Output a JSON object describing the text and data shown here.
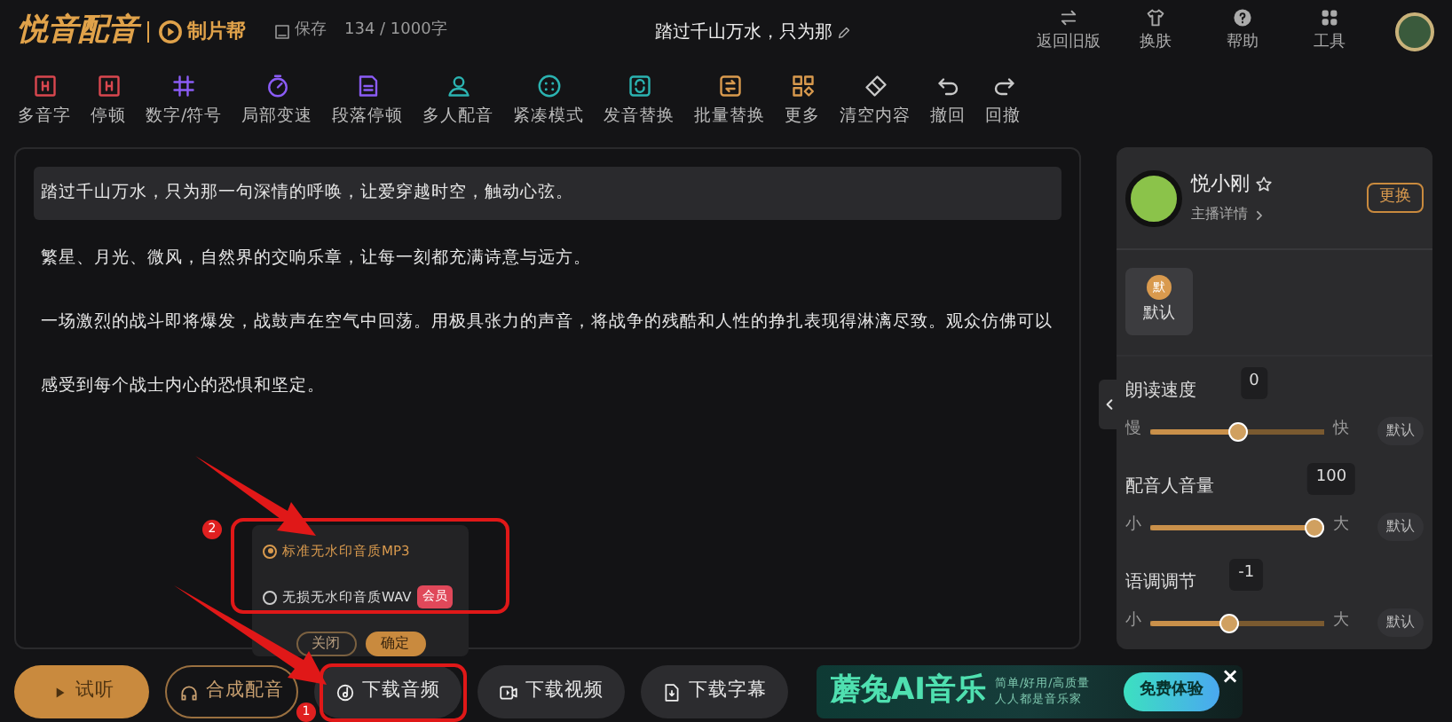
{
  "header": {
    "logo": "悦音配音",
    "brand": "制片帮",
    "save": "保存",
    "count": "134 / 1000字",
    "title": "踏过千山万水，只为那",
    "actions": [
      {
        "label": "返回旧版",
        "kind": "swap"
      },
      {
        "label": "换肤",
        "kind": "shirt"
      },
      {
        "label": "帮助",
        "kind": "help"
      },
      {
        "label": "工具",
        "kind": "grid"
      }
    ]
  },
  "toolbar": [
    {
      "label": "多音字",
      "kind": "framed",
      "color": "#d9474f"
    },
    {
      "label": "停顿",
      "kind": "framed",
      "color": "#d9474f"
    },
    {
      "label": "数字/符号",
      "kind": "hash",
      "color": "#8b5cf6"
    },
    {
      "label": "局部变速",
      "kind": "timer",
      "color": "#8b5cf6"
    },
    {
      "label": "段落停顿",
      "kind": "doc",
      "color": "#8b5cf6"
    },
    {
      "label": "多人配音",
      "kind": "people",
      "color": "#2bb3b1"
    },
    {
      "label": "紧凑模式",
      "kind": "dots",
      "color": "#2bb3b1"
    },
    {
      "label": "发音替换",
      "kind": "cycle",
      "color": "#2bb3b1"
    },
    {
      "label": "批量替换",
      "kind": "swapbox",
      "color": "#d99a4e"
    },
    {
      "label": "更多",
      "kind": "more",
      "color": "#d99a4e"
    },
    {
      "label": "清空内容",
      "kind": "brush",
      "color": "#c9c9c9"
    },
    {
      "label": "撤回",
      "kind": "undo",
      "color": "#c9c9c9"
    },
    {
      "label": "回撤",
      "kind": "redo",
      "color": "#c9c9c9"
    }
  ],
  "editor": {
    "paragraphs": [
      {
        "text": "踏过千山万水，只为那一句深情的呼唤，让爱穿越时空，触动心弦。",
        "selected": true
      },
      {
        "text": "繁星、月光、微风，自然界的交响乐章，让每一刻都充满诗意与远方。",
        "selected": false
      },
      {
        "text": "一场激烈的战斗即将爆发，战鼓声在空气中回荡。用极具张力的声音，将战争的残酷和人性的挣扎表现得淋漓尽致。观众仿佛可以感受到每个战士内心的恐惧和坚定。",
        "selected": false
      }
    ]
  },
  "download_popup": {
    "options": [
      {
        "label": "标准无水印音质MP3",
        "selected": true
      },
      {
        "label": "无损无水印音质WAV",
        "selected": false,
        "badge": "会员"
      }
    ],
    "buttons": [
      {
        "label": "关闭",
        "kind": "outline"
      },
      {
        "label": "确定",
        "kind": "primary"
      }
    ]
  },
  "voice_panel": {
    "name": "悦小刚",
    "detail": "主播详情",
    "change": "更换",
    "emotions": [
      {
        "label": "默认",
        "icon_text": "默",
        "selected": true
      }
    ],
    "sliders": [
      {
        "label": "朗读速度",
        "reading": "0",
        "min_label": "慢",
        "max_label": "快",
        "level": 0.5,
        "reset": "默认"
      },
      {
        "label": "配音人音量",
        "reading": "100",
        "min_label": "小",
        "max_label": "大",
        "level": 1.0,
        "reset": "默认"
      },
      {
        "label": "语调调节",
        "reading": "-1",
        "min_label": "小",
        "max_label": "大",
        "level": 0.45,
        "reset": "默认"
      }
    ]
  },
  "bottom_bar": {
    "buttons": [
      {
        "label": "试听",
        "kind": "play"
      },
      {
        "label": "合成配音",
        "kind": "compose"
      },
      {
        "label": "下载音频",
        "kind": "audio"
      },
      {
        "label": "下载视频",
        "kind": "video"
      },
      {
        "label": "下载字幕",
        "kind": "subtitle"
      }
    ]
  },
  "ad": {
    "title": "蘑兔AI音乐",
    "tagline": "简单/好用/高质量",
    "subline": "人人都是音乐家",
    "button": "免费体验",
    "close": "×"
  },
  "annotations": [
    {
      "number": "2"
    },
    {
      "number": "1"
    }
  ]
}
